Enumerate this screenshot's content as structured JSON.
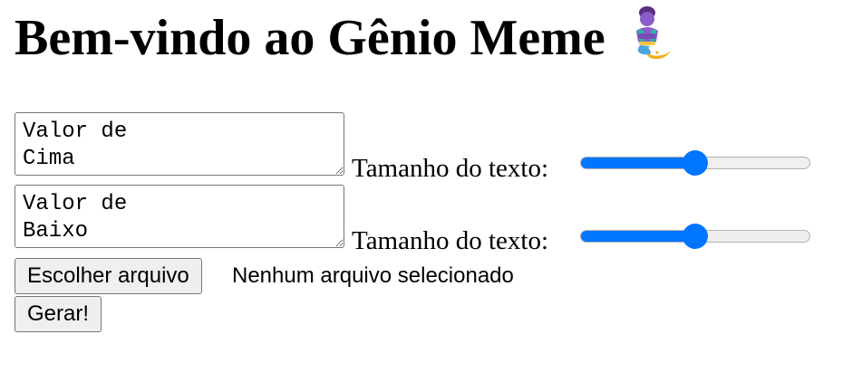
{
  "header": {
    "title": "Bem-vindo ao Gênio Meme",
    "icon": "genie-emoji"
  },
  "top_text": {
    "value": "Valor de\nCima",
    "size_label": "Tamanho do texto:",
    "size_value_fraction": 0.5
  },
  "bottom_text": {
    "value": "Valor de\nBaixo",
    "size_label": "Tamanho do texto:",
    "size_value_fraction": 0.5
  },
  "file_picker": {
    "button_label": "Escolher arquivo",
    "status": "Nenhum arquivo selecionado"
  },
  "generate": {
    "button_label": "Gerar!"
  },
  "colors": {
    "accent": "#0075ff",
    "button_bg": "#efefef",
    "border": "#767676"
  }
}
